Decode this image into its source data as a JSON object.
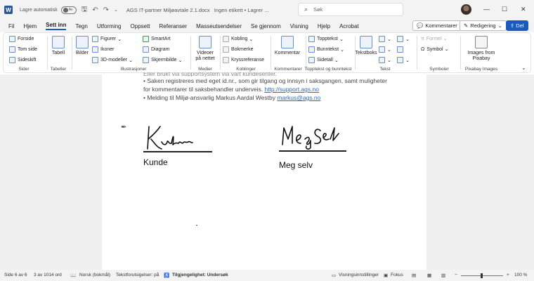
{
  "titlebar": {
    "autosave_label": "Lagre automatisk",
    "autosave_state": "Av",
    "doc_title": "AGS IT-partner Miljøavtale 2.1.docx",
    "status": "Ingen etikett • Lagrer ...",
    "search_placeholder": "Søk"
  },
  "menu": {
    "tabs": [
      "Fil",
      "Hjem",
      "Sett inn",
      "Tegn",
      "Utforming",
      "Oppsett",
      "Referanser",
      "Masseutsendelser",
      "Se gjennom",
      "Visning",
      "Hjelp",
      "Acrobat"
    ],
    "active_tab": "Sett inn",
    "comments_button": "Kommentarer",
    "editing_button": "Redigering",
    "share_button": "Del"
  },
  "ribbon": {
    "pages": {
      "items": [
        "Forside",
        "Tom side",
        "Sideskift"
      ],
      "label": "Sider"
    },
    "tables": {
      "button": "Tabell",
      "label": "Tabeller"
    },
    "illustrations": {
      "images": "Bilder",
      "items": [
        "Figurer",
        "Ikoner",
        "3D-modeller",
        "SmartArt",
        "Diagram",
        "Skjermbilde"
      ],
      "label": "Illustrasjoner"
    },
    "media": {
      "button_line1": "Videoer",
      "button_line2": "på nettet",
      "label": "Medier"
    },
    "links": {
      "items": [
        "Kobling",
        "Bokmerke",
        "Kryssreferanse"
      ],
      "label": "Koblinger"
    },
    "comments": {
      "button": "Kommentar",
      "label": "Kommentarer"
    },
    "header_footer": {
      "items": [
        "Topptekst",
        "Bunntekst",
        "Sidetall"
      ],
      "label": "Topptekst og bunntekst"
    },
    "text": {
      "button": "Tekstboks",
      "label": "Tekst"
    },
    "symbols": {
      "items": [
        "Formel",
        "Symbol"
      ],
      "label": "Symboler"
    },
    "pixabay": {
      "button_line1": "Images from",
      "button_line2": "Pixabay",
      "label": "Pixabay Images"
    }
  },
  "document": {
    "line_cut": "Eller brukt via supportsystem via vart kundesenter.",
    "bullet2_a": "• Saken registreres med eget id.nr., som gir tilgang og innsyn i saksgangen, samt muligheter",
    "bullet2_b": "for kommentarer til saksbehandler underveis.",
    "support_link": "http://support.ags.no",
    "bullet3": "• Melding til Miljø-ansvarlig Markus Aardal Westby",
    "email_link": "markus@ags.no",
    "signature_left_label": "Kunde",
    "signature_right_label": "Meg selv"
  },
  "statusbar": {
    "page": "Side 6 av 6",
    "words": "3 av 1014 ord",
    "language": "Norsk (bokmål)",
    "predictions": "Tekstforutsigelser: på",
    "accessibility": "Tilgjengelighet: Undersøk",
    "display_settings": "Visningsinnstillinger",
    "focus": "Fokus",
    "zoom": "100 %"
  },
  "colors": {
    "accent": "#185abd",
    "link": "#2b6cc4"
  }
}
